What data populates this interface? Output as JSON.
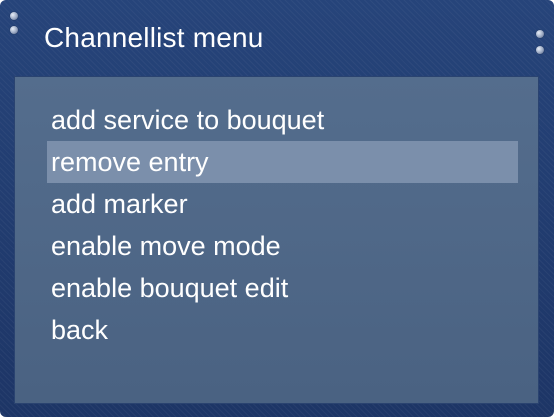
{
  "window": {
    "title": "Channellist menu"
  },
  "menu": {
    "items": [
      {
        "label": "add service to bouquet",
        "selected": false
      },
      {
        "label": "remove entry",
        "selected": true
      },
      {
        "label": "add marker",
        "selected": false
      },
      {
        "label": "enable move mode",
        "selected": false
      },
      {
        "label": "enable bouquet edit",
        "selected": false
      },
      {
        "label": "back",
        "selected": false
      }
    ]
  },
  "colors": {
    "frame": "#1e3768",
    "panel": "#4d6686",
    "highlight": "#7b8fab",
    "text": "#ffffff"
  }
}
